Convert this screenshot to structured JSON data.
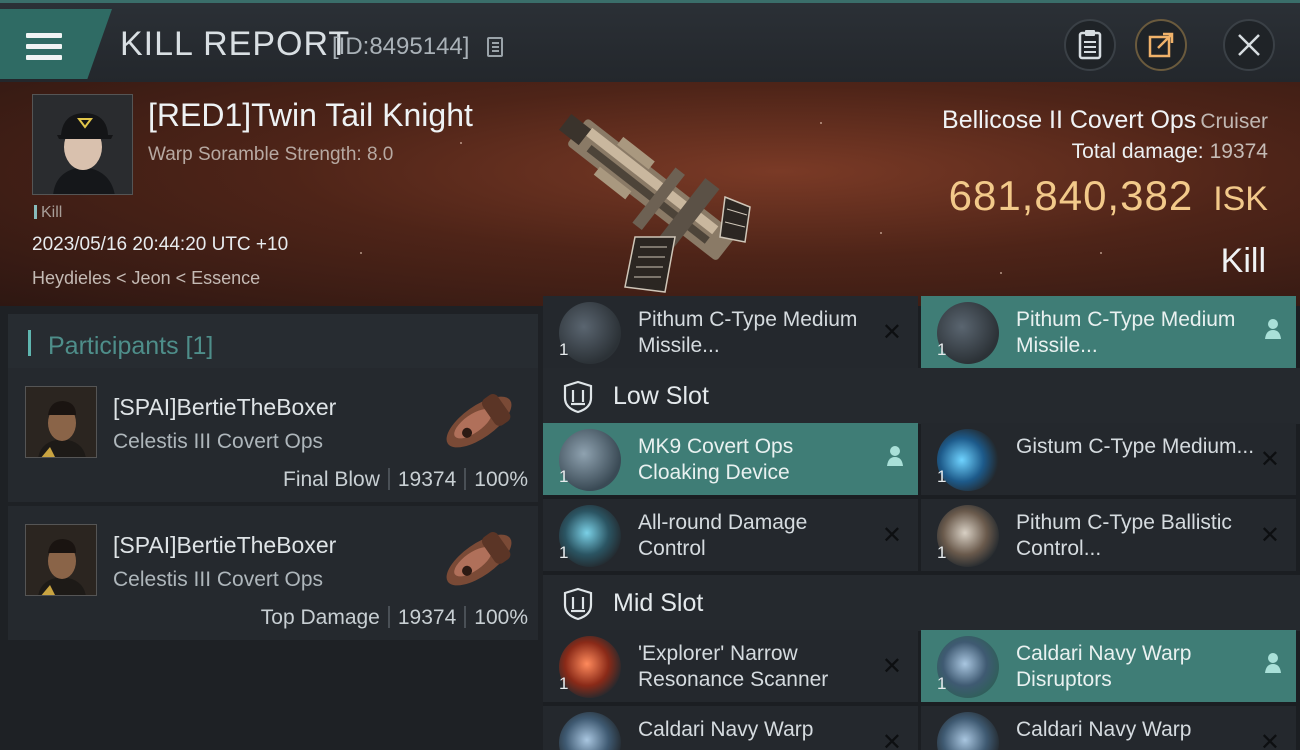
{
  "header": {
    "title": "KILL REPORT",
    "report_id": "[ID:8495144]"
  },
  "victim": {
    "name": "[RED1]Twin Tail Knight",
    "warp_scramble": "Warp Soramble Strength: 8.0",
    "tag": "Kill",
    "timestamp": "2023/05/16 20:44:20 UTC +10",
    "location": "Heydieles < Jeon < Essence",
    "ship_name": "Bellicose II Covert Ops",
    "ship_class": "Cruiser",
    "total_damage_label": "Total damage:",
    "total_damage": "19374",
    "isk_value": "681,840,382",
    "isk_unit": "ISK",
    "result": "Kill"
  },
  "participants": {
    "header": "Participants [1]",
    "items": [
      {
        "name": "[SPAI]BertieTheBoxer",
        "ship": "Celestis III Covert Ops",
        "role": "Final Blow",
        "damage": "19374",
        "percent": "100%"
      },
      {
        "name": "[SPAI]BertieTheBoxer",
        "ship": "Celestis III Covert Ops",
        "role": "Top Damage",
        "damage": "19374",
        "percent": "100%"
      }
    ]
  },
  "modules": {
    "high": [
      {
        "name": "Pithum C-Type Medium Missile...",
        "qty": "1",
        "status": "destroyed"
      },
      {
        "name": "Pithum C-Type Medium Missile...",
        "qty": "1",
        "status": "dropped"
      }
    ],
    "low_label": "Low Slot",
    "low": [
      {
        "name": "MK9 Covert Ops Cloaking Device",
        "qty": "1",
        "status": "dropped"
      },
      {
        "name": "Gistum C-Type Medium...",
        "qty": "1",
        "status": "destroyed"
      },
      {
        "name": "All-round Damage Control",
        "qty": "1",
        "status": "destroyed"
      },
      {
        "name": "Pithum C-Type Ballistic Control...",
        "qty": "1",
        "status": "destroyed"
      }
    ],
    "mid_label": "Mid Slot",
    "mid": [
      {
        "name": "'Explorer' Narrow Resonance Scanner",
        "qty": "1",
        "status": "destroyed"
      },
      {
        "name": "Caldari Navy Warp Disruptors",
        "qty": "1",
        "status": "dropped"
      },
      {
        "name": "Caldari Navy Warp",
        "qty": "1",
        "status": "destroyed"
      },
      {
        "name": "Caldari Navy Warp",
        "qty": "1",
        "status": "destroyed"
      }
    ]
  },
  "colors": {
    "accent_teal": "#3f7d76",
    "isk_gold": "#f2c98a",
    "hero_red": "#5a2a1c"
  },
  "icons": {
    "menu": "hamburger-icon",
    "copy": "copy-icon",
    "clipboard": "clipboard-icon",
    "share": "share-icon",
    "close": "close-icon",
    "slot": "shield-slot-icon",
    "dropped": "person-icon",
    "destroyed": "x-icon"
  }
}
